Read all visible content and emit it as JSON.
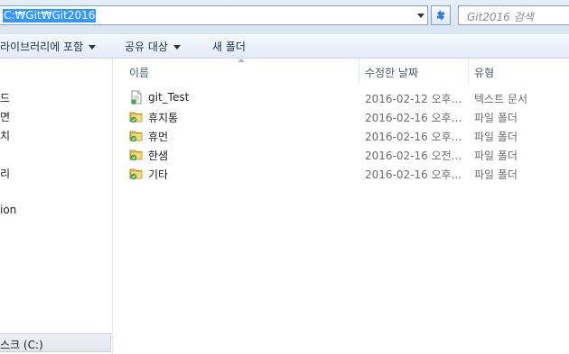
{
  "address": {
    "path": "C:₩Git₩Git2016"
  },
  "search": {
    "placeholder": "Git2016 검색"
  },
  "toolbar": {
    "library_label": "라이브러리에 포함",
    "share_label": "공유 대상",
    "new_folder_label": "새 폴더"
  },
  "nav": {
    "items": [
      "드",
      "면",
      "치",
      "리",
      "ion"
    ],
    "drive": "스크 (C:)"
  },
  "columns": {
    "name": "이름",
    "modified": "수정한 날짜",
    "type": "유형"
  },
  "files": [
    {
      "name": "git_Test",
      "date": "2016-02-12 오후...",
      "type": "텍스트 문서",
      "icon": "text-file-icon"
    },
    {
      "name": "휴지통",
      "date": "2016-02-16 오후...",
      "type": "파일 폴더",
      "icon": "folder-icon"
    },
    {
      "name": "휴먼",
      "date": "2016-02-16 오후...",
      "type": "파일 폴더",
      "icon": "folder-icon"
    },
    {
      "name": "한샘",
      "date": "2016-02-16 오전...",
      "type": "파일 폴더",
      "icon": "folder-icon"
    },
    {
      "name": "기타",
      "date": "2016-02-16 오후...",
      "type": "파일 폴더",
      "icon": "folder-icon"
    }
  ]
}
